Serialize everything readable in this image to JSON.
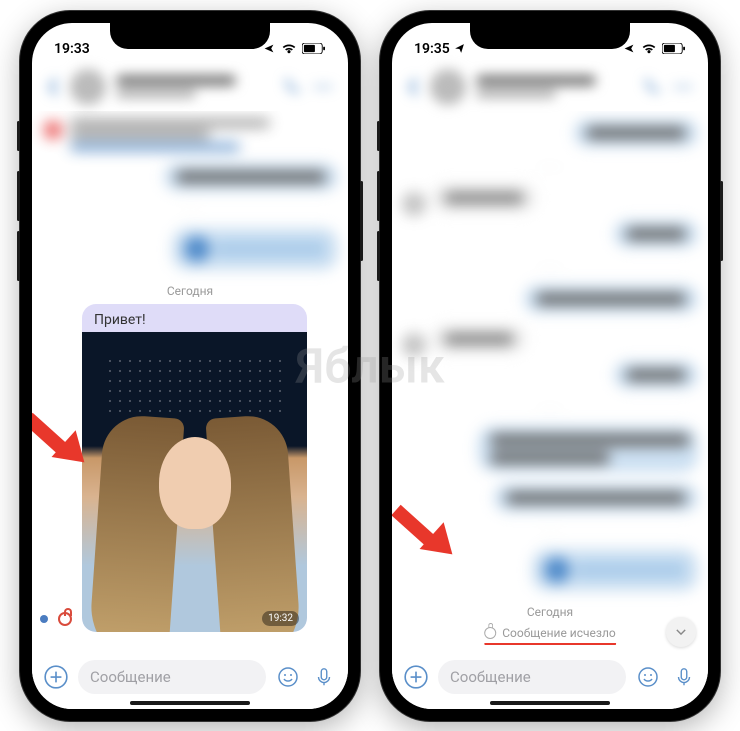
{
  "watermark": "Яблык",
  "left": {
    "status_time": "19:33",
    "date_separator": "Сегодня",
    "message_text": "Привет!",
    "message_time": "19:32",
    "input_placeholder": "Сообщение"
  },
  "right": {
    "status_time": "19:35",
    "date_separator": "Сегодня",
    "disappeared_text": "Сообщение исчезло",
    "input_placeholder": "Сообщение"
  }
}
